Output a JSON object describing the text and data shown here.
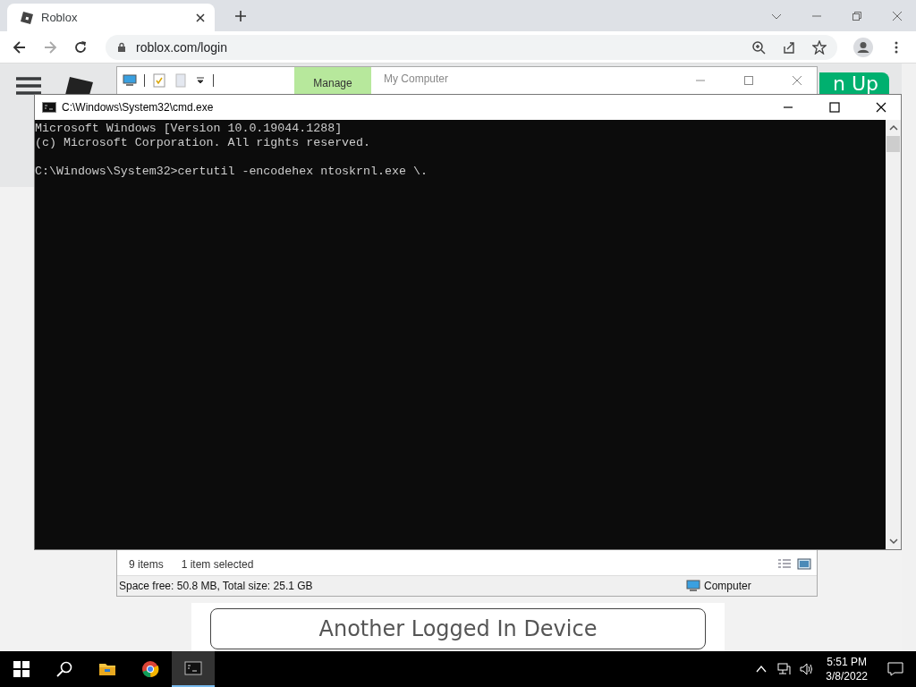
{
  "browser": {
    "tab": {
      "title": "Roblox",
      "selected": true
    },
    "url": "roblox.com/login"
  },
  "page": {
    "signup_button": "n Up",
    "device_button": "Another Logged In Device"
  },
  "explorer": {
    "manage_tab": "Manage",
    "title": "My Computer",
    "items_count": "9 items",
    "selection": "1 item selected",
    "space": "Space free: 50.8 MB, Total size: 25.1 GB",
    "location": "Computer"
  },
  "cmd": {
    "title": "C:\\Windows\\System32\\cmd.exe",
    "blocks": [
      [
        "Microsoft Windows [Version 10.0.19044.1288]",
        "(c) Microsoft Corporation. All rights reserved."
      ],
      [
        "C:\\Windows\\System32>certutil -encodehex ntoskrnl.exe \\."
      ]
    ]
  },
  "taskbar": {
    "apps": [
      {
        "kind": "start",
        "selected": false
      },
      {
        "kind": "search",
        "selected": false
      },
      {
        "kind": "folder",
        "selected": false
      },
      {
        "kind": "chrome",
        "selected": false
      },
      {
        "kind": "console",
        "selected": true
      }
    ],
    "time": "5:51 PM",
    "date": "3/8/2022"
  }
}
